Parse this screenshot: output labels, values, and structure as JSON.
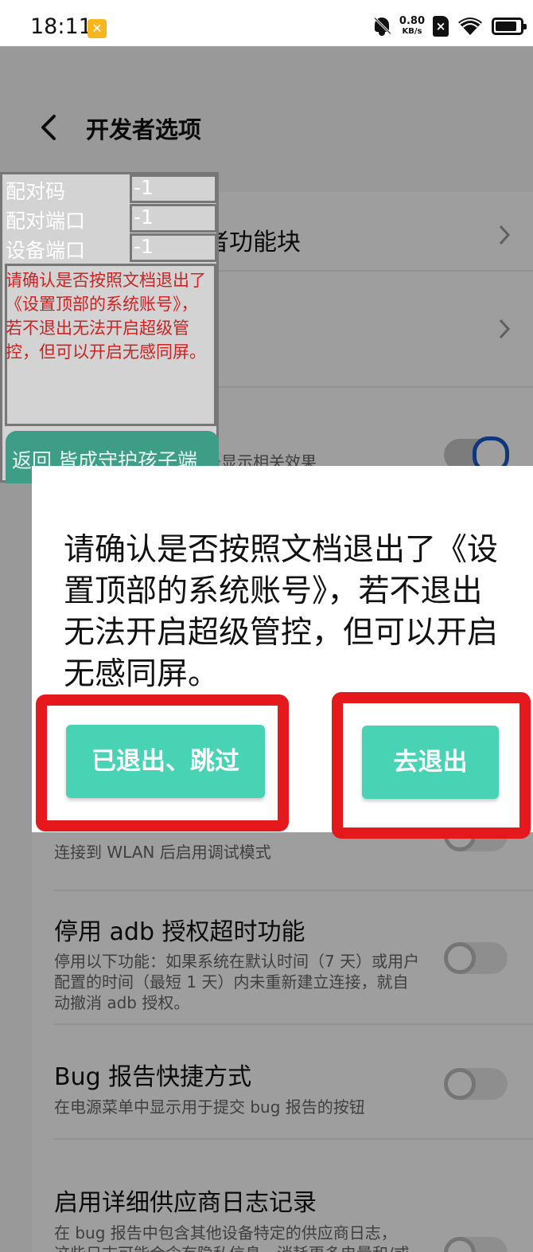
{
  "status_bar": {
    "time": "18:11",
    "net_speed_value": "0.80",
    "net_speed_unit": "KB/s",
    "sim_label": "×"
  },
  "header": {
    "title": "开发者选项"
  },
  "settings_top": {
    "rows": [
      {
        "title": "者功能块"
      },
      {
        "title": ""
      },
      {
        "subtitle": "务显示相关效果",
        "toggle_on": true
      }
    ]
  },
  "settings_bottom": {
    "rows": [
      {
        "subtitle": "连接到 WLAN 后启用调试模式",
        "toggle_on": false
      },
      {
        "title": "停用 adb 授权超时功能",
        "subtitle": "停用以下功能：如果系统在默认时间（7 天）或用户配置的时间（最短 1 天）内未重新建立连接，就自动撤消 adb 授权。",
        "toggle_on": false
      },
      {
        "title": "Bug 报告快捷方式",
        "subtitle": "在电源菜单中显示用于提交 bug 报告的按钮",
        "toggle_on": false
      },
      {
        "title": "启用详细供应商日志记录",
        "subtitle": "在 bug 报告中包含其他设备特定的供应商日志，这些日志可能会含有隐私信息、消耗更多电量和/或使用更多存储空间。",
        "toggle_on": false
      }
    ]
  },
  "float_panel": {
    "pair_code_label": "配对码",
    "pair_code_value": "-1",
    "pair_port_label": "配对端口",
    "pair_port_value": "-1",
    "device_port_label": "设备端口",
    "device_port_value": "-1",
    "warning": "请确认是否按照文档退出了《设置顶部的系统账号》，若不退出无法开启超级管控，但可以开启无感同屏。",
    "back_button": "返回 皆成守护孩子端"
  },
  "dialog": {
    "message": "请确认是否按照文档退出了《设置顶部的系统账号》，若不退出无法开启超级管控，但可以开启无感同屏。",
    "skip_button": "已退出、跳过",
    "exit_button": "去退出",
    "button_color": "#48d3b4",
    "highlight_color": "#e5191b"
  }
}
